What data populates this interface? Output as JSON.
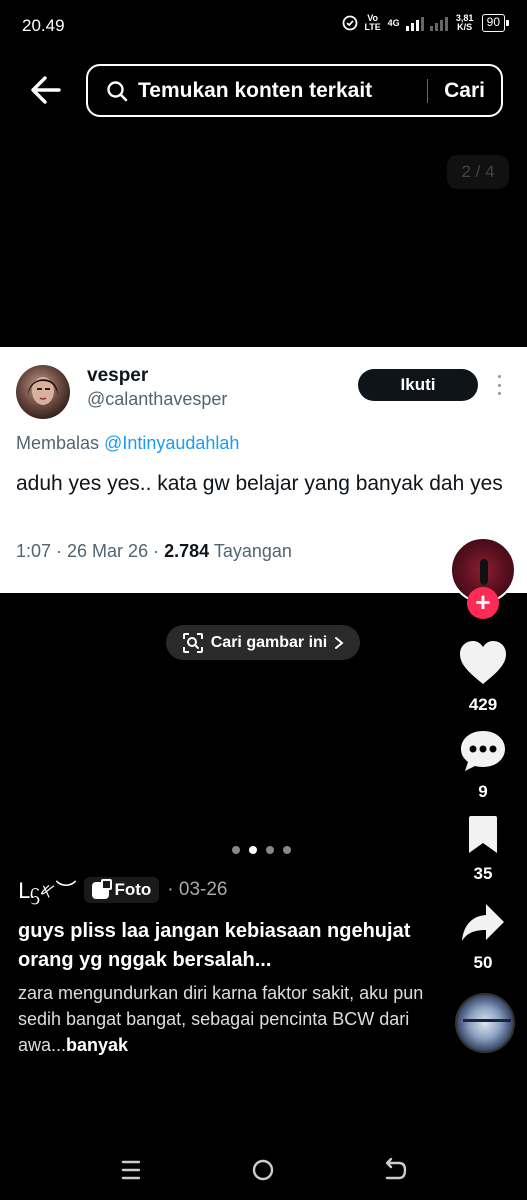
{
  "status_bar": {
    "time": "20.49",
    "volte": "Vo LTE",
    "network": "4G",
    "speed": "3,81 K/S",
    "battery": "90"
  },
  "search": {
    "placeholder": "Temukan konten terkait",
    "submit_label": "Cari"
  },
  "page_counter": "2 / 4",
  "tweet": {
    "name": "vesper",
    "handle": "@calanthavesper",
    "follow_label": "Ikuti",
    "reply_prefix": "Membalas",
    "reply_mention": "@Intinyaudahlah",
    "text": "aduh yes yes.. kata gw belajar yang banyak dah yes",
    "meta_prefix": "1:07 · 26 Mar 26 · ",
    "views": "2.784",
    "views_label": "Tayangan"
  },
  "search_image_label": "Cari gambar ini",
  "rail": {
    "likes": "429",
    "comments": "9",
    "saves": "35",
    "shares": "50"
  },
  "carousel": {
    "total": 4,
    "active": 1
  },
  "post": {
    "author": "ᒪᦓ𐤀︶",
    "type_label": "Foto",
    "date": "· 03-26",
    "title": "guys pliss laa jangan kebiasaan ngehujat orang yg nggak bersalah...",
    "body": "zara mengundurkan diri karna faktor sakit, aku pun sedih bangat bangat, sebagai pencinta BCW dari awa...",
    "more_label": "banyak"
  },
  "colors": {
    "accent_red": "#fe2c55",
    "mention_blue": "#1d9bf0"
  },
  "icons": {
    "back": "arrow-left-icon",
    "search": "search-icon",
    "like": "heart-icon",
    "comment": "comment-icon",
    "save": "bookmark-icon",
    "share": "share-icon"
  }
}
